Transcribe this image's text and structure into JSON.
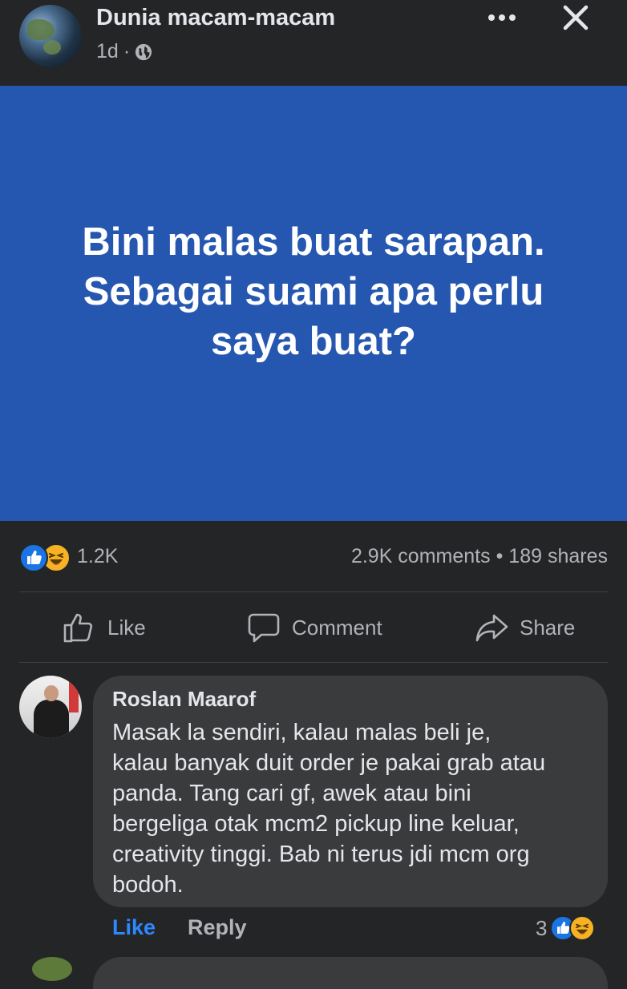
{
  "post": {
    "page_name": "Dunia macam-macam",
    "time": "1d",
    "separator": "·",
    "privacy_icon": "globe-icon",
    "more_icon": "more-horizontal-icon",
    "close_icon": "close-icon",
    "text_lines": [
      "Bini malas buat sarapan.",
      "Sebagai suami apa perlu",
      "saya buat?"
    ],
    "background_color": "#2657b0"
  },
  "reactions": {
    "icons": [
      "like-reaction-icon",
      "haha-reaction-icon"
    ],
    "count": "1.2K",
    "comments": "2.9K comments",
    "dot": "•",
    "shares": "189 shares"
  },
  "actions": {
    "like_label": "Like",
    "comment_label": "Comment",
    "share_label": "Share"
  },
  "comment": {
    "author": "Roslan Maarof",
    "lines": [
      "Masak la sendiri, kalau malas beli je,",
      "kalau banyak duit order je pakai grab atau",
      "panda. Tang cari gf, awek atau bini",
      "bergeliga otak mcm2 pickup line keluar,",
      "creativity tinggi. Bab ni terus jdi mcm org",
      "bodoh."
    ],
    "like_label": "Like",
    "reply_label": "Reply",
    "reaction_count": "3"
  },
  "colors": {
    "background": "#242526",
    "link_blue": "#2d88ff",
    "like_blue": "#1b74e4",
    "haha_yellow": "#f7b125"
  }
}
